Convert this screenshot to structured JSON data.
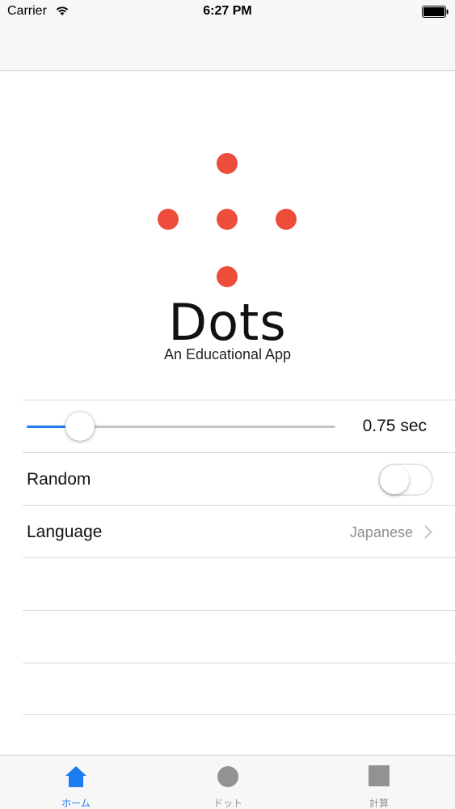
{
  "status_bar": {
    "carrier": "Carrier",
    "time": "6:27 PM"
  },
  "logo": {
    "dot_color": "#ee4d3b",
    "title": "Dots",
    "subtitle": "An Educational App"
  },
  "settings": {
    "interval": {
      "value_label": "0.75 sec",
      "fraction": 0.14
    },
    "random": {
      "label": "Random",
      "on": false
    },
    "language": {
      "label": "Language",
      "value": "Japanese"
    }
  },
  "tabs": [
    {
      "label": "ホーム",
      "icon": "home-icon",
      "active": true
    },
    {
      "label": "ドット",
      "icon": "circle-icon",
      "active": false
    },
    {
      "label": "計算",
      "icon": "square-icon",
      "active": false
    }
  ],
  "colors": {
    "accent": "#1e7cf2",
    "inactive": "#929292"
  }
}
